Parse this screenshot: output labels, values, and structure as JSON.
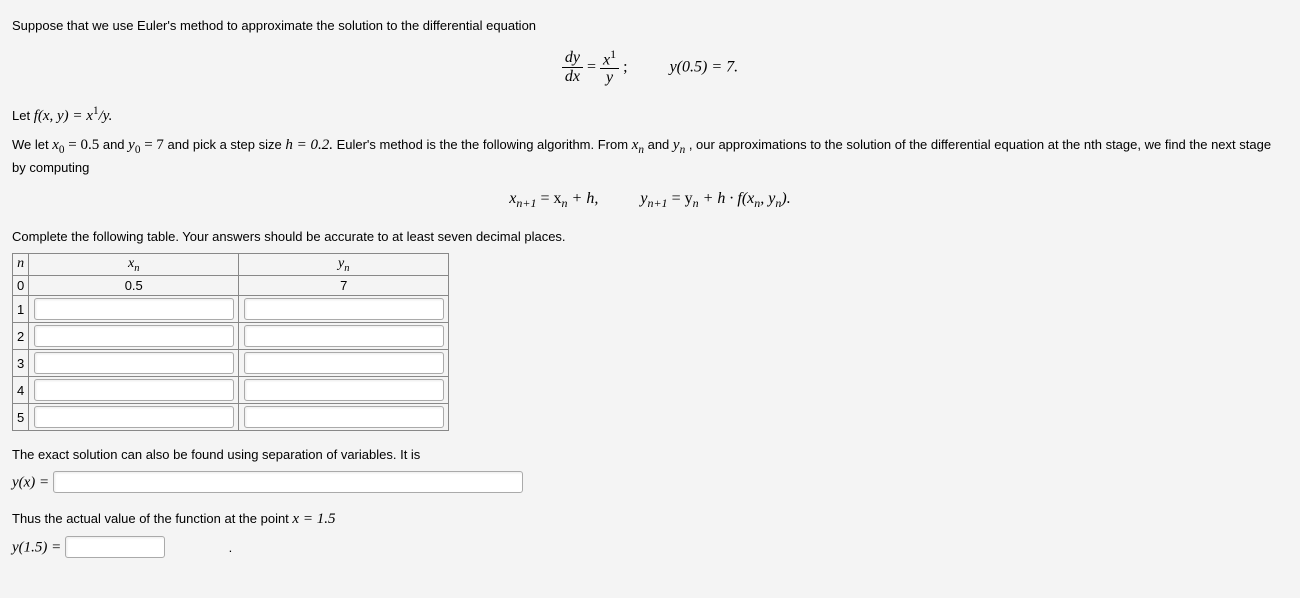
{
  "intro1": "Suppose that we use Euler's method to approximate the solution to the differential equation",
  "eq_main_lhs_num": "dy",
  "eq_main_lhs_den": "dx",
  "eq_main_eq": " = ",
  "eq_main_rhs_num_var": "x",
  "eq_main_rhs_num_exp": "1",
  "eq_main_rhs_den": "y",
  "eq_main_tail": ";",
  "eq_main_cond": "y(0.5) = 7.",
  "let_prefix": "Let ",
  "let_f": "f(x, y) = x",
  "let_f_exp": "1",
  "let_f_tail": "/y.",
  "welet1": "We let ",
  "x0eq": "x",
  "sub0a": "0",
  "eq05": " = 0.5",
  "and1": " and ",
  "y0eq": "y",
  "sub0b": "0",
  "eq7": " = 7",
  "pick": " and pick a step size ",
  "hvar": "h = 0.2.",
  "afterpick": " Euler's method is the the following algorithm. From ",
  "xn": "x",
  "subn1": "n",
  "and2": " and ",
  "yn": "y",
  "subn2": "n",
  "afterxnyn": " , our approximations to the solution of the differential equation at the nth stage, we find the next stage by computing",
  "recur_x_lhs": "x",
  "recur_x_sub": "n+1",
  "recur_x_mid": " = x",
  "recur_x_sub2": "n",
  "recur_x_tail": " + h,",
  "recur_y_lhs": "y",
  "recur_y_sub": "n+1",
  "recur_y_mid": " = y",
  "recur_y_sub2": "n",
  "recur_y_tail": " + h · f(x",
  "recur_y_sub3": "n",
  "recur_y_tail2": ", y",
  "recur_y_sub4": "n",
  "recur_y_tail3": ").",
  "complete": "Complete the following table. Your answers should be accurate to at least seven decimal places.",
  "th_n": "n",
  "th_xn": "x",
  "th_xn_sub": "n",
  "th_yn": "y",
  "th_yn_sub": "n",
  "rows": [
    {
      "n": "0",
      "x": "0.5",
      "y": "7"
    },
    {
      "n": "1",
      "x": "",
      "y": ""
    },
    {
      "n": "2",
      "x": "",
      "y": ""
    },
    {
      "n": "3",
      "x": "",
      "y": ""
    },
    {
      "n": "4",
      "x": "",
      "y": ""
    },
    {
      "n": "5",
      "x": "",
      "y": ""
    }
  ],
  "exact": "The exact solution can also be found using separation of variables. It is",
  "yx_label": "y(x) = ",
  "thus": "Thus the actual value of the function at the point ",
  "xeq15": "x = 1.5",
  "y15_label": "y(1.5) = ",
  "period": "."
}
